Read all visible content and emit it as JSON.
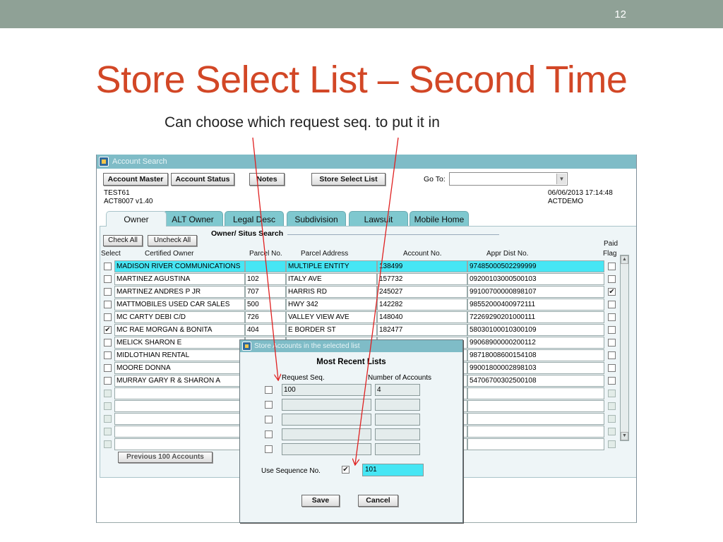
{
  "slide": {
    "number": "12",
    "title": "Store Select List – Second Time",
    "subtitle": "Can choose which request seq. to put it in"
  },
  "colors": {
    "title": "#d24726",
    "topbar": "#8fa196",
    "titlebar": "#7fbcc7",
    "highlight": "#46e6f4",
    "arrow": "#e02020"
  },
  "window": {
    "title": "Account Search",
    "toolbar": {
      "account_master": "Account Master",
      "account_status": "Account Status",
      "notes": "Notes",
      "store_select_list": "Store Select List",
      "goto_label": "Go To:"
    },
    "info_left_1": "TEST61",
    "info_left_2": "ACT8007  v1.40",
    "info_right_1": "06/06/2013 17:14:48",
    "info_right_2": "ACTDEMO"
  },
  "tabs": [
    "Owner",
    "ALT Owner",
    "Legal Desc",
    "Subdivision",
    "Lawsuit",
    "Mobile Home"
  ],
  "search_group": {
    "label": "Owner/ Situs Search",
    "check_all": "Check All",
    "uncheck_all": "Uncheck  All",
    "previous_button": "Previous 100 Accounts"
  },
  "table": {
    "headers": {
      "select": "Select",
      "owner": "Certified Owner",
      "parcel_no": "Parcel No.",
      "address": "Parcel Address",
      "account": "Account No.",
      "appr": "Appr Dist No.",
      "paid_1": "Paid",
      "paid_2": "Flag"
    },
    "rows": [
      {
        "owner": "MADISON RIVER COMMUNICATIONS",
        "parcel": "",
        "address": "MULTIPLE ENTITY",
        "account": "138499",
        "appr": "97485000502299999"
      },
      {
        "owner": "MARTINEZ AGUSTINA",
        "parcel": "102",
        "address": "ITALY AVE",
        "account": "157732",
        "appr": "09200103000500103"
      },
      {
        "owner": "MARTINEZ ANDRES P JR",
        "parcel": "707",
        "address": "HARRIS RD",
        "account": "245027",
        "appr": "99100700000898107"
      },
      {
        "owner": "MATTMOBILES USED CAR SALES",
        "parcel": "500",
        "address": "HWY 342",
        "account": "142282",
        "appr": "98552000400972111"
      },
      {
        "owner": "MC CARTY DEBI C/D",
        "parcel": "726",
        "address": "VALLEY VIEW AVE",
        "account": "148040",
        "appr": "72269290201000111"
      },
      {
        "owner": "MC RAE MORGAN & BONITA",
        "parcel": "404",
        "address": "E BORDER ST",
        "account": "182477",
        "appr": "58030100010300109"
      },
      {
        "owner": "MELICK SHARON E",
        "parcel": "",
        "address": "",
        "account": "",
        "appr": "99068900000200112"
      },
      {
        "owner": "MIDLOTHIAN RENTAL",
        "parcel": "",
        "address": "",
        "account": "",
        "appr": "98718008600154108"
      },
      {
        "owner": "MOORE DONNA",
        "parcel": "",
        "address": "",
        "account": "",
        "appr": "99001800002898103"
      },
      {
        "owner": "MURRAY GARY R & SHARON A",
        "parcel": "",
        "address": "",
        "account": "",
        "appr": "54706700302500108"
      }
    ],
    "check_marks": [
      "",
      "",
      "",
      "",
      "",
      "✔",
      "",
      "",
      "",
      "",
      "",
      "",
      "",
      "",
      ""
    ],
    "paid_marks": [
      "",
      "",
      "✔",
      "",
      "",
      "",
      "",
      "",
      "",
      "",
      "",
      "",
      "",
      "",
      ""
    ]
  },
  "dialog": {
    "title": "Store Accounts in the selected list",
    "heading": "Most Recent Lists",
    "col_seq": "Request Seq.",
    "col_count": "Number of Accounts",
    "rows": [
      {
        "seq": "100",
        "count": "4"
      },
      {
        "seq": "",
        "count": ""
      },
      {
        "seq": "",
        "count": ""
      },
      {
        "seq": "",
        "count": ""
      },
      {
        "seq": "",
        "count": ""
      }
    ],
    "use_seq_label": "Use Sequence No.",
    "use_seq_check": "✔",
    "use_seq_value": "101",
    "save": "Save",
    "cancel": "Cancel"
  }
}
